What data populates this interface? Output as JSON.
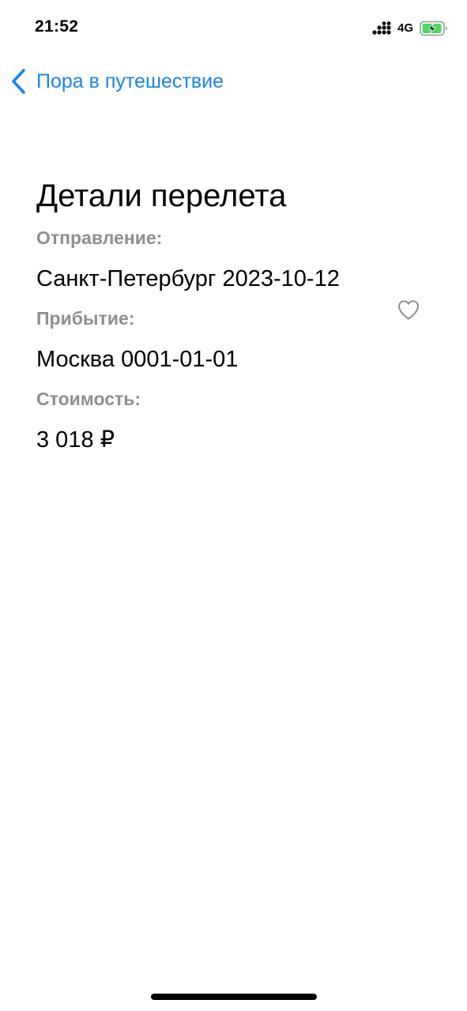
{
  "status_bar": {
    "time": "21:52",
    "network": "4G",
    "battery_icon": "battery-charging-icon",
    "signal_icon": "signal-bars-icon"
  },
  "nav": {
    "back_label": "Пора в путешествие",
    "back_icon": "chevron-left-icon",
    "accent_color": "#1a84f1"
  },
  "details": {
    "title": "Детали перелета",
    "departure_label": "Отправление:",
    "departure_value": "Санкт-Петербург 2023-10-12",
    "arrival_label": "Прибытие:",
    "arrival_value": "Москва 0001-01-01",
    "price_label": "Стоимость:",
    "price_value": "3 018 ₽",
    "favorite_icon": "heart-outline-icon"
  }
}
